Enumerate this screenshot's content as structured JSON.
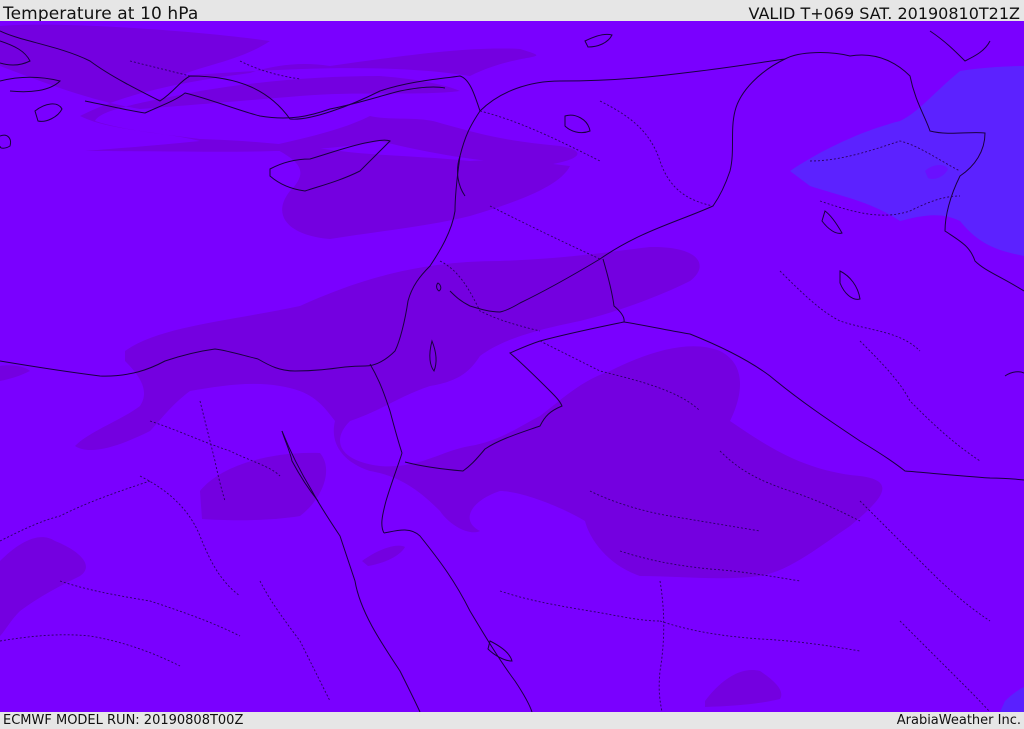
{
  "header": {
    "title": "Temperature at 10 hPa",
    "valid_time": "VALID T+069 SAT. 20190810T21Z"
  },
  "footer": {
    "model_run": "ECMWF MODEL RUN: 20190808T00Z",
    "credit": "ArabiaWeather Inc."
  },
  "map": {
    "field": "temperature",
    "level": "10 hPa",
    "colors": {
      "base": "#7a00ff",
      "warm_patch": "#7600dd",
      "cool_patch": "#5a22ff",
      "borders": "#1a0033"
    }
  }
}
